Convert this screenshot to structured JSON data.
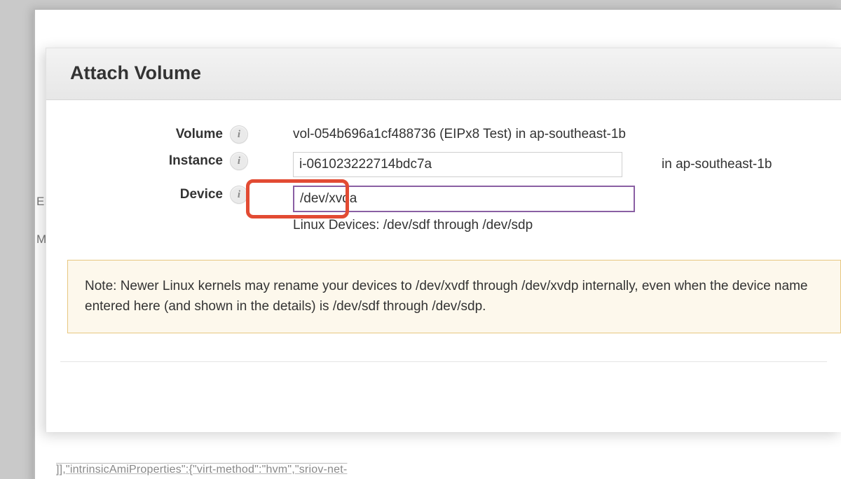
{
  "dialog": {
    "title": "Attach Volume"
  },
  "fields": {
    "volume": {
      "label": "Volume",
      "value": "vol-054b696a1cf488736 (EIPx8 Test) in ap-southeast-1b"
    },
    "instance": {
      "label": "Instance",
      "value": "i-061023222714bdc7a",
      "suffix": "in ap-southeast-1b"
    },
    "device": {
      "label": "Device",
      "value": "/dev/xvda",
      "hint": "Linux Devices: /dev/sdf through /dev/sdp"
    }
  },
  "note": "Note: Newer Linux kernels may rename your devices to /dev/xvdf through /dev/xvdp internally, even when the device name entered here (and shown in the details) is /dev/sdf through /dev/sdp.",
  "background": {
    "code": "]],\"intrinsicAmiProperties\":{\"virt-method\":\"hvm\",\"sriov-net-",
    "frag_a": "EI",
    "frag_b": "M"
  },
  "info_glyph": "i"
}
